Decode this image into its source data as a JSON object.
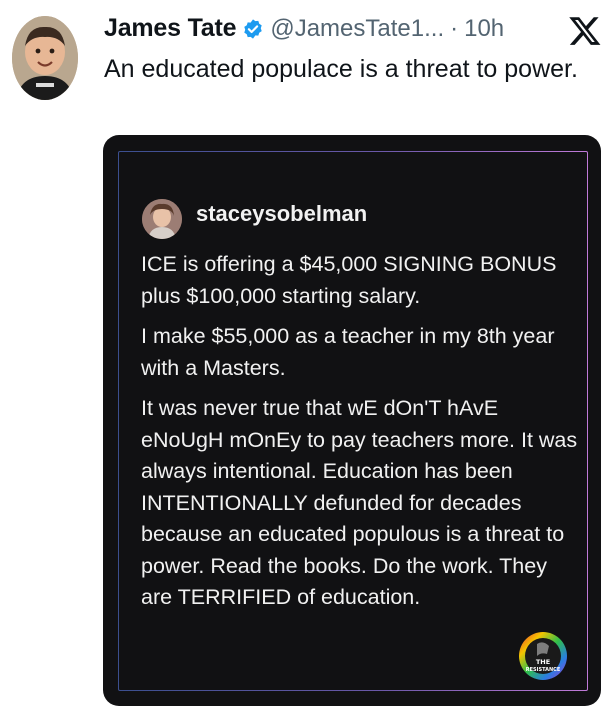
{
  "tweet": {
    "author_name": "James Tate",
    "handle": "@JamesTate1...",
    "separator": "·",
    "time": "10h",
    "text": "An educated populace is a threat to power.",
    "icons": {
      "avatar": "profile-photo",
      "verified": "verified-badge-icon",
      "platform": "x-logo-icon"
    },
    "colors": {
      "verified": "#1d9bf0",
      "handle": "#536471"
    }
  },
  "embedded_post": {
    "username": "staceysobelman",
    "paragraphs": [
      "ICE is offering a $45,000 SIGNING BONUS plus $100,000 starting salary.",
      "I make $55,000 as a teacher in my 8th year with a Masters.",
      "It was never true that wE dOn'T hAvE eNoUgH mOnEy to pay teachers more. It was always intentional. Education has been INTENTIONALLY defunded for decades because an educated populous is a threat to power. Read the books. Do the work. They are TERRIFIED of education."
    ],
    "badge_text": [
      "THE",
      "RESISTANCE"
    ],
    "colors": {
      "background": "#111113",
      "text": "#f1f1f1"
    }
  }
}
